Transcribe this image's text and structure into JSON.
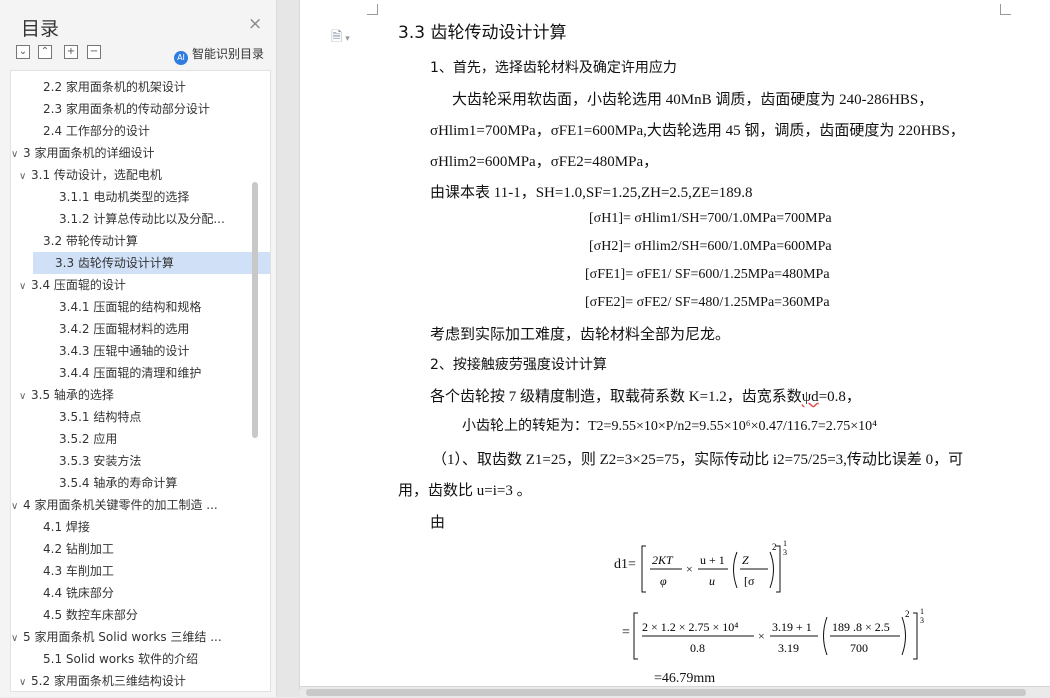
{
  "toc": {
    "title": "目录",
    "close_icon": "×",
    "tool_icons": [
      "collapse-all-icon",
      "expand-all-icon",
      "add-heading-icon",
      "remove-heading-icon"
    ],
    "smart_label": "智能识别目录",
    "items": [
      {
        "text": "2.2 家用面条机的机架设计",
        "level": 2
      },
      {
        "text": "2.3 家用面条机的传动部分设计",
        "level": 2
      },
      {
        "text": "2.4 工作部分的设计",
        "level": 2
      },
      {
        "text": "3 家用面条机的详细设计",
        "level": 1,
        "chev": "∨"
      },
      {
        "text": "3.1 传动设计，选配电机",
        "level": 2,
        "chev": "∨"
      },
      {
        "text": "3.1.1  电动机类型的选择",
        "level": 3
      },
      {
        "text": "3.1.2  计算总传动比以及分配...",
        "level": 3
      },
      {
        "text": "3.2  带轮传动计算",
        "level": 2
      },
      {
        "text": "3.3  齿轮传动设计计算",
        "level": 2,
        "selected": true
      },
      {
        "text": "3.4  压面辊的设计",
        "level": 2,
        "chev": "∨"
      },
      {
        "text": "3.4.1  压面辊的结构和规格",
        "level": 3
      },
      {
        "text": "3.4.2  压面辊材料的选用",
        "level": 3
      },
      {
        "text": "3.4.3  压辊中通轴的设计",
        "level": 3
      },
      {
        "text": "3.4.4  压面辊的清理和维护",
        "level": 3
      },
      {
        "text": "3.5  轴承的选择",
        "level": 2,
        "chev": "∨"
      },
      {
        "text": "3.5.1  结构特点",
        "level": 3
      },
      {
        "text": "3.5.2  应用",
        "level": 3
      },
      {
        "text": "3.5.3  安装方法",
        "level": 3
      },
      {
        "text": "3.5.4  轴承的寿命计算",
        "level": 3
      },
      {
        "text": "4  家用面条机关键零件的加工制造 ...",
        "level": 1,
        "chev": "∨"
      },
      {
        "text": "4.1  焊接",
        "level": 2
      },
      {
        "text": "4.2  钻削加工",
        "level": 2
      },
      {
        "text": "4.3  车削加工",
        "level": 2
      },
      {
        "text": "4.4  铣床部分",
        "level": 2
      },
      {
        "text": "4.5  数控车床部分",
        "level": 2
      },
      {
        "text": "5  家用面条机 Solid works 三维结 ...",
        "level": 1,
        "chev": "∨"
      },
      {
        "text": "5.1 Solid works 软件的介绍",
        "level": 2
      },
      {
        "text": "5.2  家用面条机三维结构设计",
        "level": 2,
        "chev": "∨"
      }
    ]
  },
  "doc": {
    "heading": "3.3  齿轮传动设计计算",
    "p1": "1、首先，选择齿轮材料及确定许用应力",
    "p2": "大齿轮采用软齿面，小齿轮选用 40MnB 调质，齿面硬度为 240-286HBS，",
    "p3": "σHlim1=700MPa，σFE1=600MPa,大齿轮选用 45 钢，调质，齿面硬度为 220HBS，",
    "p4": "σHlim2=600MPa，σFE2=480MPa，",
    "p5": "由课本表 11-1，SH=1.0,SF=1.25,ZH=2.5,ZE=189.8",
    "eq1": "[σH1]= σHlim1/SH=700/1.0MPa=700MPa",
    "eq2": "[σH2]= σHlim2/SH=600/1.0MPa=600MPa",
    "eq3": "[σFE1]= σFE1/ SF=600/1.25MPa=480MPa",
    "eq4": "[σFE2]= σFE2/ SF=480/1.25MPa=360MPa",
    "p6": "考虑到实际加工难度，齿轮材料全部为尼龙。",
    "p7": "2、按接触疲劳强度设计计算",
    "p8a": "各个齿轮按 7 级精度制造，取载荷系数 K=1.2，齿宽系数",
    "p8b": "ψd",
    "p8c": "=0.8，",
    "p9": "小齿轮上的转矩为：T2=9.55×10×P/n2=9.55×10⁶×0.47/116.7=2.75×10⁴",
    "p10": "（1）、取齿数 Z1=25，则 Z2=3×25=75，实际传动比 i2=75/25=3,传动比误差 0，可",
    "p11": "用，齿数比 u=i=3 。",
    "p12": "由",
    "d1_label": "d1=",
    "f1": {
      "num1": "2KT",
      "den1": "φ",
      "times": "×",
      "num2": "u + 1",
      "den2": "u",
      "num3": "Z",
      "den3": "[σ",
      "exp2": "2",
      "exp": "1",
      "expden": "3"
    },
    "f2": {
      "prefix": "=",
      "num1": "2 × 1.2 × 2.75 × 10⁴",
      "den1": "0.8",
      "times": "×",
      "num2": "3.19 + 1",
      "den2": "3.19",
      "num3": "189 .8 × 2.5",
      "den3": "700",
      "exp2": "2",
      "exp": "1",
      "expden": "3"
    },
    "result": "=46.79mm"
  },
  "colors": {
    "selected": "#cfe0f7",
    "panel": "#f4f4f4",
    "wavy": "#e05050"
  }
}
